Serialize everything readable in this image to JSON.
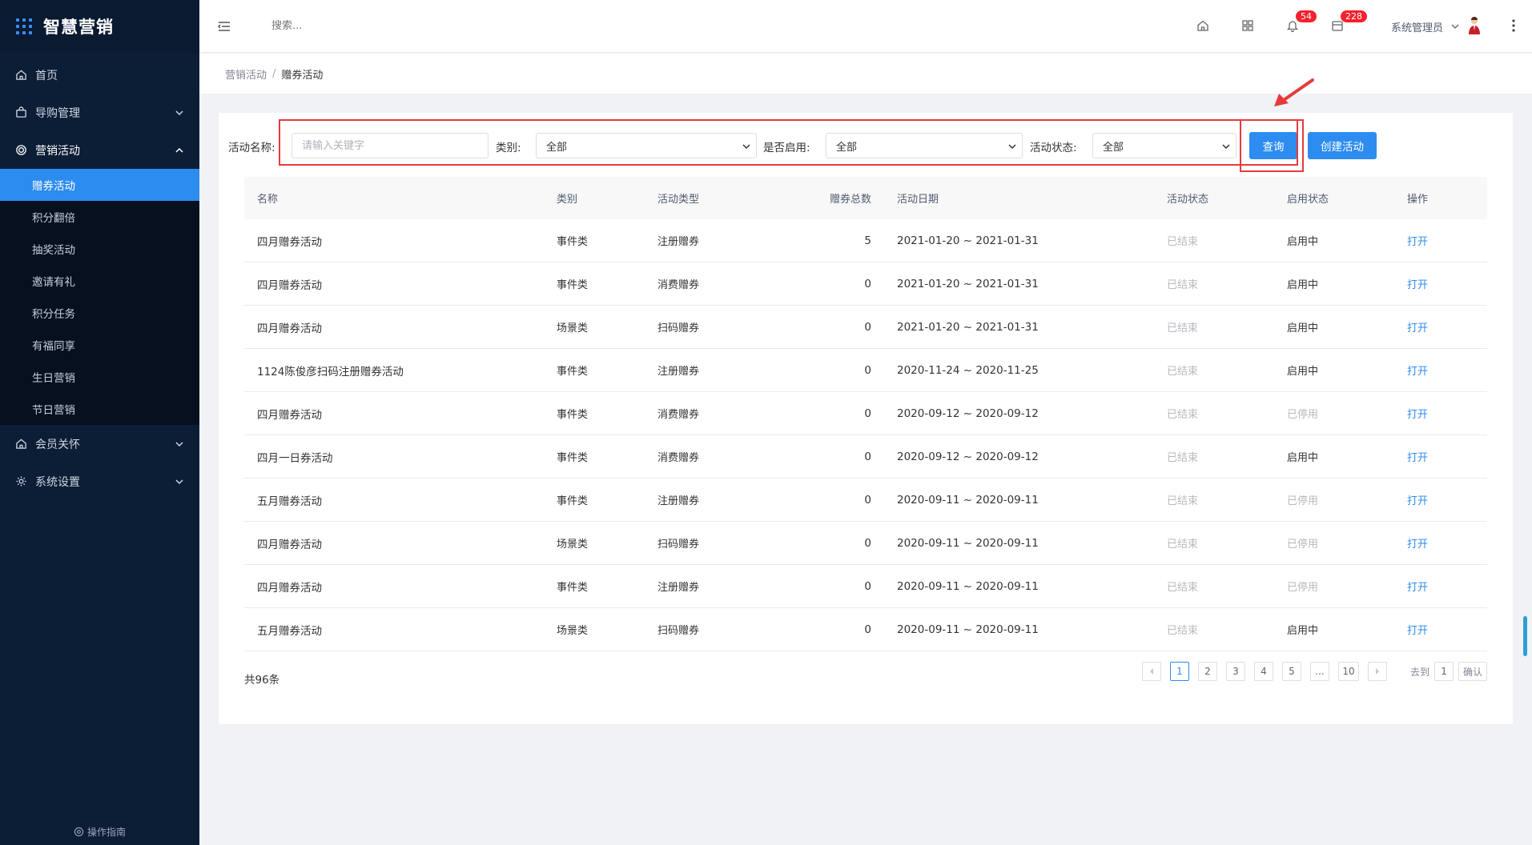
{
  "app": {
    "title": "智慧营销"
  },
  "sidebar": {
    "items": [
      {
        "label": "首页",
        "icon": "home-icon"
      },
      {
        "label": "导购管理",
        "icon": "bag-icon"
      },
      {
        "label": "营销活动",
        "icon": "coin-icon"
      },
      {
        "label": "会员关怀",
        "icon": "home-icon"
      },
      {
        "label": "系统设置",
        "icon": "gear-icon"
      }
    ],
    "subitems": [
      "赠券活动",
      "积分翻倍",
      "抽奖活动",
      "邀请有礼",
      "积分任务",
      "有福同享",
      "生日营销",
      "节日营销"
    ],
    "guide": "操作指南"
  },
  "header": {
    "search_placeholder": "搜索...",
    "badge_notifications": "54",
    "badge_messages": "228",
    "user_name": "系统管理员"
  },
  "breadcrumb": {
    "parent": "营销活动",
    "separator": "/",
    "current": "赠券活动"
  },
  "filters": {
    "name_label": "活动名称:",
    "name_placeholder": "请输入关键字",
    "type_label": "类别:",
    "type_value": "全部",
    "enabled_label": "是否启用:",
    "enabled_value": "全部",
    "status_label": "活动状态:",
    "status_value": "全部",
    "query_button": "查询",
    "create_button": "创建活动"
  },
  "table": {
    "headers": [
      "名称",
      "类别",
      "活动类型",
      "赠券总数",
      "活动日期",
      "活动状态",
      "启用状态",
      "操作"
    ],
    "rows": [
      {
        "name": "四月赠券活动",
        "category": "事件类",
        "type": "注册赠券",
        "total": "5",
        "date": "2021-01-20 ~ 2021-01-31",
        "status": "已结束",
        "enabled": "启用中",
        "action": "打开"
      },
      {
        "name": "四月赠券活动",
        "category": "事件类",
        "type": "消费赠券",
        "total": "0",
        "date": "2021-01-20 ~ 2021-01-31",
        "status": "已结束",
        "enabled": "启用中",
        "action": "打开"
      },
      {
        "name": "四月赠券活动",
        "category": "场景类",
        "type": "扫码赠券",
        "total": "0",
        "date": "2021-01-20 ~ 2021-01-31",
        "status": "已结束",
        "enabled": "启用中",
        "action": "打开"
      },
      {
        "name": "1124陈俊彦扫码注册赠券活动",
        "category": "事件类",
        "type": "注册赠券",
        "total": "0",
        "date": "2020-11-24 ~ 2020-11-25",
        "status": "已结束",
        "enabled": "启用中",
        "action": "打开"
      },
      {
        "name": "四月赠券活动",
        "category": "事件类",
        "type": "消费赠券",
        "total": "0",
        "date": "2020-09-12 ~ 2020-09-12",
        "status": "已结束",
        "enabled": "已停用",
        "action": "打开"
      },
      {
        "name": "四月一日券活动",
        "category": "事件类",
        "type": "消费赠券",
        "total": "0",
        "date": "2020-09-12 ~ 2020-09-12",
        "status": "已结束",
        "enabled": "启用中",
        "action": "打开"
      },
      {
        "name": "五月赠券活动",
        "category": "事件类",
        "type": "注册赠券",
        "total": "0",
        "date": "2020-09-11 ~ 2020-09-11",
        "status": "已结束",
        "enabled": "已停用",
        "action": "打开"
      },
      {
        "name": "四月赠券活动",
        "category": "场景类",
        "type": "扫码赠券",
        "total": "0",
        "date": "2020-09-11 ~ 2020-09-11",
        "status": "已结束",
        "enabled": "已停用",
        "action": "打开"
      },
      {
        "name": "四月赠券活动",
        "category": "事件类",
        "type": "注册赠券",
        "total": "0",
        "date": "2020-09-11 ~ 2020-09-11",
        "status": "已结束",
        "enabled": "已停用",
        "action": "打开"
      },
      {
        "name": "五月赠券活动",
        "category": "场景类",
        "type": "扫码赠券",
        "total": "0",
        "date": "2020-09-11 ~ 2020-09-11",
        "status": "已结束",
        "enabled": "启用中",
        "action": "打开"
      }
    ]
  },
  "pagination": {
    "total_text": "共96条",
    "pages": [
      "1",
      "2",
      "3",
      "4",
      "5",
      "...",
      "10"
    ],
    "current": "1",
    "goto_label": "去到",
    "goto_value": "1",
    "confirm": "确认"
  },
  "colors": {
    "sidebar_bg": "#0c1d36",
    "accent": "#2d8cf0",
    "annotation_red": "#e63b3b",
    "badge_red": "#f5222d"
  }
}
